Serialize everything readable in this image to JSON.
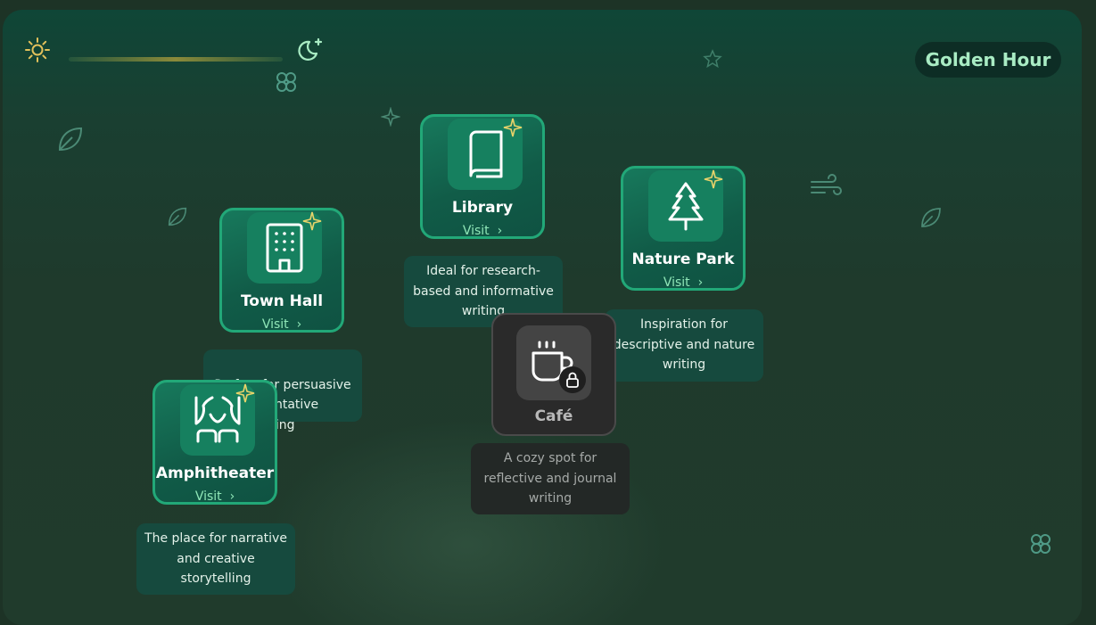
{
  "header": {
    "sun_icon": "sun-icon",
    "moon_icon": "moon-stars-icon",
    "time_of_day_badge": "Golden Hour"
  },
  "locations": [
    {
      "name": "Town Hall",
      "visit": "Visit",
      "icon": "building-icon",
      "description": "Perfect for persuasive and argumentative writing",
      "description_visible": "Perfect for persuasive\numentative\nting"
    },
    {
      "name": "Library",
      "visit": "Visit",
      "icon": "book-icon",
      "description": "Ideal for research-based and informative writing"
    },
    {
      "name": "Nature Park",
      "visit": "Visit",
      "icon": "pine-tree-icon",
      "description": "Inspiration for descriptive and nature writing"
    },
    {
      "name": "Amphitheater",
      "visit": "Visit",
      "icon": "theater-icon",
      "description": "The place for narrative and creative storytelling"
    },
    {
      "name": "Café",
      "icon": "coffee-cup-icon",
      "locked": true,
      "description": "A cozy spot for reflective and journal writing"
    }
  ],
  "colors": {
    "card_border": "#22a878",
    "card_fill": "#17795c",
    "visit_text": "#8fe6b7",
    "badge_text": "#a9ecc4",
    "sparkle": "#e8d36a"
  }
}
